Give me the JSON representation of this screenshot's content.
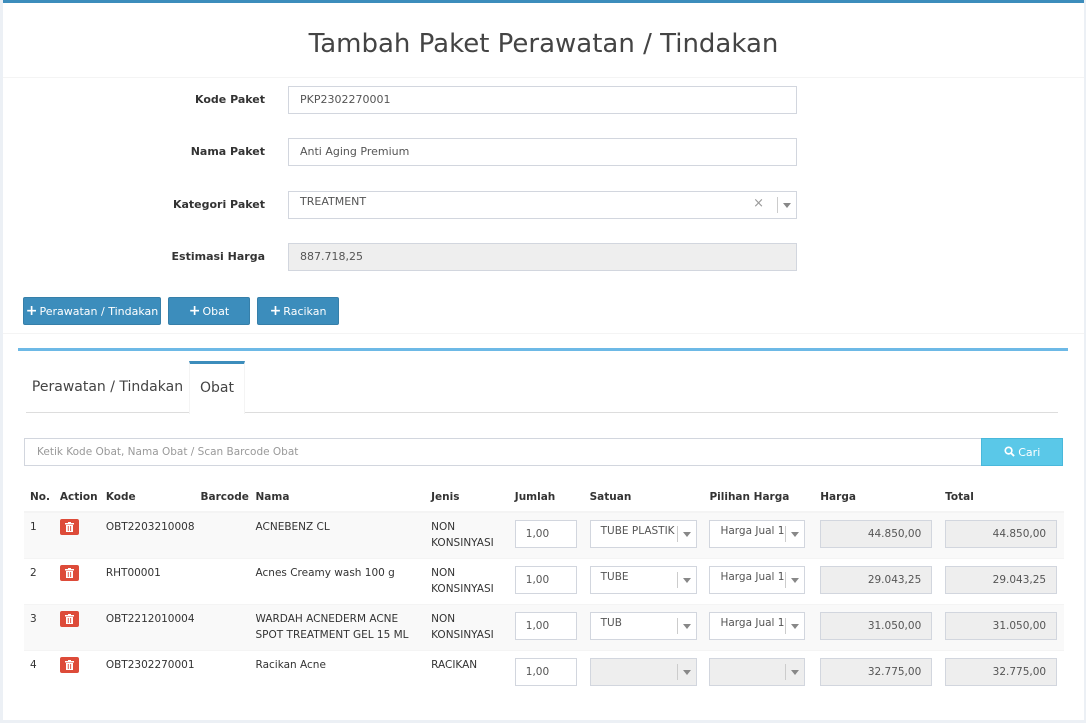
{
  "page": {
    "title": "Tambah Paket Perawatan / Tindakan"
  },
  "form": {
    "kode_label": "Kode Paket",
    "kode_value": "PKP2302270001",
    "nama_label": "Nama Paket",
    "nama_value": "Anti Aging Premium",
    "kategori_label": "Kategori Paket",
    "kategori_value": "TREATMENT",
    "kategori_clear": "×",
    "estimasi_label": "Estimasi Harga",
    "estimasi_value": "887.718,25"
  },
  "buttons": {
    "perawatan": "Perawatan / Tindakan",
    "obat": "Obat",
    "racikan": "Racikan",
    "plus": "+"
  },
  "tabs": [
    {
      "label": "Perawatan / Tindakan"
    },
    {
      "label": "Obat"
    }
  ],
  "search": {
    "placeholder": "Ketik Kode Obat, Nama Obat / Scan Barcode Obat",
    "button": "Cari"
  },
  "table": {
    "headers": [
      "No.",
      "Action",
      "Kode",
      "Barcode",
      "Nama",
      "Jenis",
      "Jumlah",
      "Satuan",
      "Pilihan Harga",
      "Harga",
      "Total"
    ],
    "rows": [
      {
        "no": "1",
        "kode": "OBT2203210008",
        "barcode": "",
        "nama": "ACNEBENZ CL",
        "jenis": "NON KONSINYASI",
        "jumlah": "1,00",
        "satuan": "TUBE PLASTIK",
        "pilihan": "Harga Jual 1",
        "harga": "44.850,00",
        "total": "44.850,00"
      },
      {
        "no": "2",
        "kode": "RHT00001",
        "barcode": "",
        "nama": "Acnes Creamy wash 100 g",
        "jenis": "NON KONSINYASI",
        "jumlah": "1,00",
        "satuan": "TUBE",
        "pilihan": "Harga Jual 1",
        "harga": "29.043,25",
        "total": "29.043,25"
      },
      {
        "no": "3",
        "kode": "OBT2212010004",
        "barcode": "",
        "nama": "WARDAH ACNEDERM ACNE SPOT TREATMENT GEL 15 ML",
        "jenis": "NON KONSINYASI",
        "jumlah": "1,00",
        "satuan": "TUB",
        "pilihan": "Harga Jual 1",
        "harga": "31.050,00",
        "total": "31.050,00"
      },
      {
        "no": "4",
        "kode": "OBT2302270001",
        "barcode": "",
        "nama": "Racikan Acne",
        "jenis": "RACIKAN",
        "jumlah": "1,00",
        "satuan": "",
        "pilihan": "",
        "harga": "32.775,00",
        "total": "32.775,00"
      }
    ]
  },
  "colors": {
    "primary": "#3c8dbc",
    "info": "#5ac8e8",
    "danger": "#dd4b39"
  }
}
